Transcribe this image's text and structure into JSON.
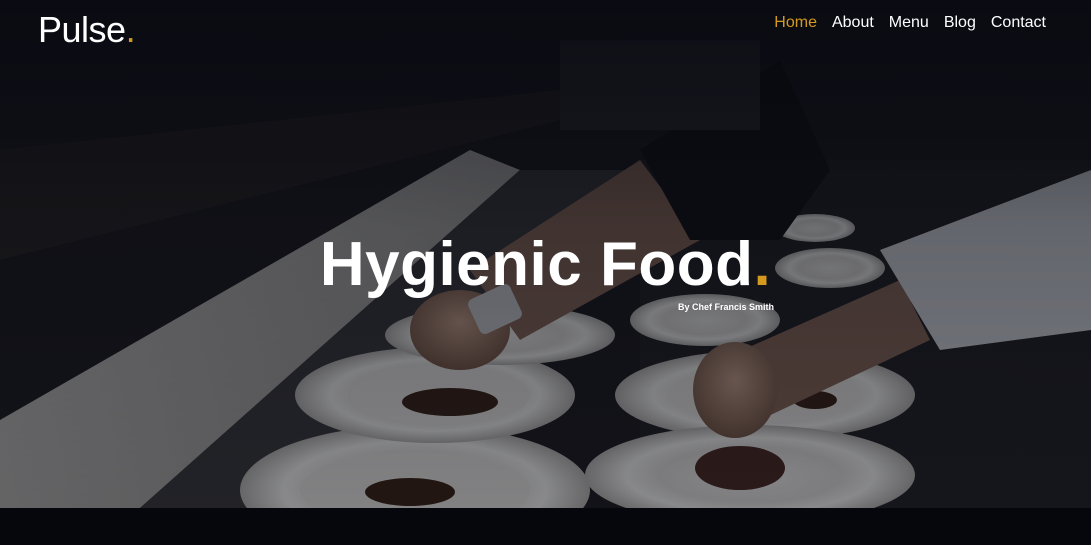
{
  "brand": {
    "name": "Pulse",
    "dot": ".",
    "accent_color": "#d49a1e"
  },
  "nav": {
    "items": [
      {
        "label": "Home",
        "active": true
      },
      {
        "label": "About",
        "active": false
      },
      {
        "label": "Menu",
        "active": false
      },
      {
        "label": "Blog",
        "active": false
      },
      {
        "label": "Contact",
        "active": false
      }
    ]
  },
  "hero": {
    "title": "Hygienic Food",
    "title_dot": ".",
    "byline": "By Chef Francis Smith",
    "background_image": "chef-plating-food-photo"
  }
}
